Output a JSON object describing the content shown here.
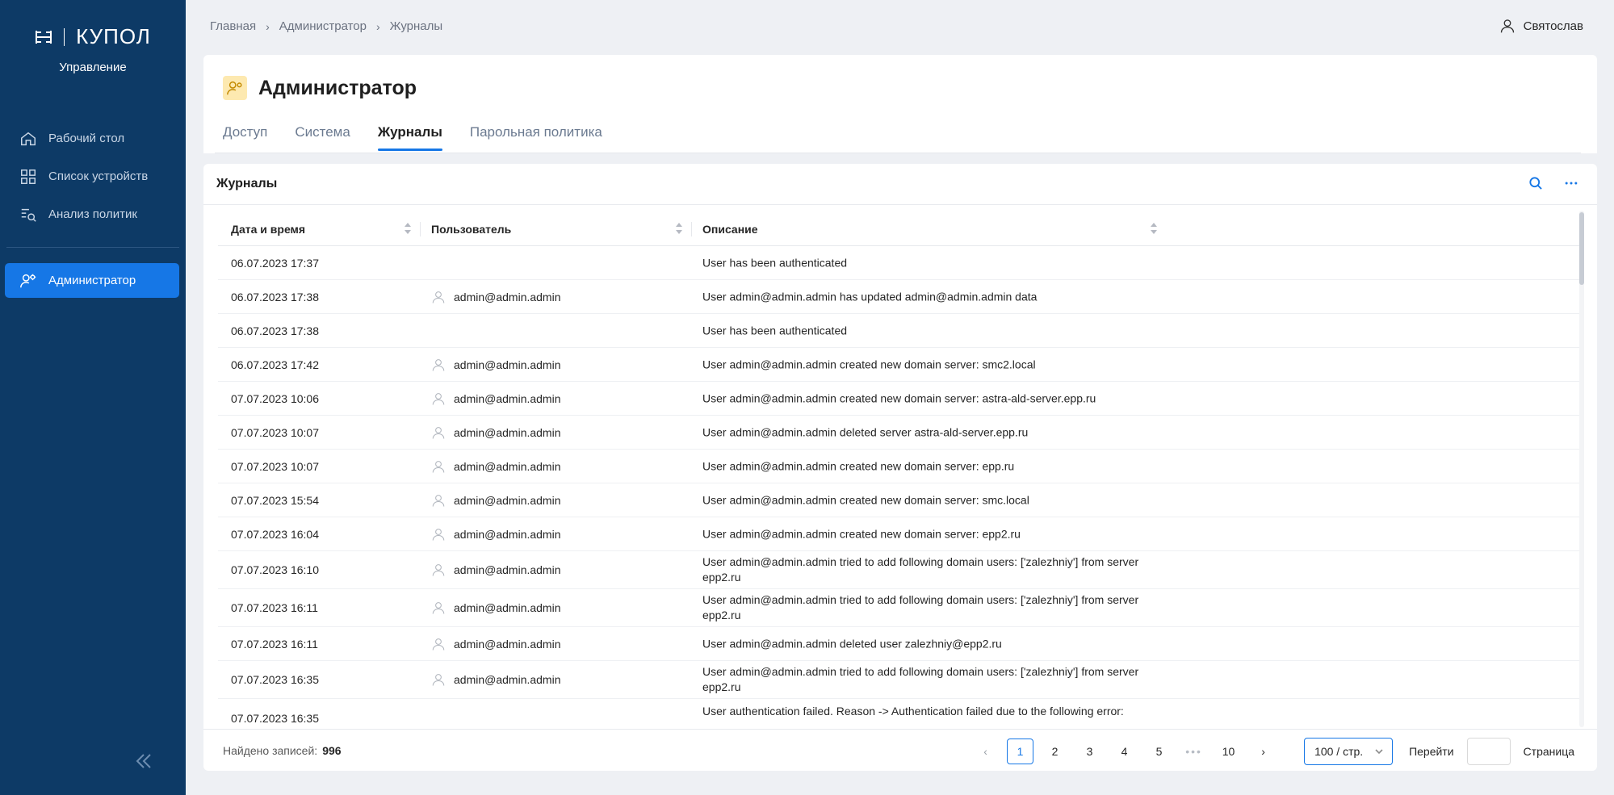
{
  "sidebar": {
    "logo_text": "КУПОЛ",
    "logo_sub": "Управление",
    "items": [
      {
        "label": "Рабочий стол"
      },
      {
        "label": "Список устройств"
      },
      {
        "label": "Анализ политик"
      }
    ],
    "active_item": "Администратор"
  },
  "breadcrumb": [
    "Главная",
    "Администратор",
    "Журналы"
  ],
  "user": {
    "name": "Святослав"
  },
  "page": {
    "title": "Администратор",
    "tabs": [
      "Доступ",
      "Система",
      "Журналы",
      "Парольная политика"
    ],
    "active_tab": "Журналы"
  },
  "journal": {
    "title": "Журналы",
    "columns": [
      "Дата и время",
      "Пользователь",
      "Описание"
    ],
    "rows": [
      {
        "date": "06.07.2023 17:37",
        "user": "",
        "desc": "User has been authenticated"
      },
      {
        "date": "06.07.2023 17:38",
        "user": "admin@admin.admin",
        "desc": "User admin@admin.admin has updated admin@admin.admin data"
      },
      {
        "date": "06.07.2023 17:38",
        "user": "",
        "desc": "User has been authenticated"
      },
      {
        "date": "06.07.2023 17:42",
        "user": "admin@admin.admin",
        "desc": "User admin@admin.admin created new domain server: smc2.local"
      },
      {
        "date": "07.07.2023 10:06",
        "user": "admin@admin.admin",
        "desc": "User admin@admin.admin created new domain server: astra-ald-server.epp.ru"
      },
      {
        "date": "07.07.2023 10:07",
        "user": "admin@admin.admin",
        "desc": "User admin@admin.admin deleted server astra-ald-server.epp.ru"
      },
      {
        "date": "07.07.2023 10:07",
        "user": "admin@admin.admin",
        "desc": "User admin@admin.admin created new domain server: epp.ru"
      },
      {
        "date": "07.07.2023 15:54",
        "user": "admin@admin.admin",
        "desc": "User admin@admin.admin created new domain server: smc.local"
      },
      {
        "date": "07.07.2023 16:04",
        "user": "admin@admin.admin",
        "desc": "User admin@admin.admin created new domain server: epp2.ru"
      },
      {
        "date": "07.07.2023 16:10",
        "user": "admin@admin.admin",
        "desc": "User admin@admin.admin tried to add following domain users: ['zalezhniy'] from server epp2.ru"
      },
      {
        "date": "07.07.2023 16:11",
        "user": "admin@admin.admin",
        "desc": "User admin@admin.admin tried to add following domain users: ['zalezhniy'] from server epp2.ru"
      },
      {
        "date": "07.07.2023 16:11",
        "user": "admin@admin.admin",
        "desc": "User admin@admin.admin deleted user zalezhniy@epp2.ru"
      },
      {
        "date": "07.07.2023 16:35",
        "user": "admin@admin.admin",
        "desc": "User admin@admin.admin tried to add following domain users: ['zalezhniy'] from server epp2.ru"
      },
      {
        "date": "07.07.2023 16:35",
        "user": "",
        "desc": "User authentication failed. Reason -> Authentication failed due to the following error:"
      }
    ]
  },
  "footer": {
    "found_label": "Найдено записей:",
    "found_count": "996",
    "pages": [
      "1",
      "2",
      "3",
      "4",
      "5",
      "•••",
      "10"
    ],
    "current_page": "1",
    "page_size": "100 / стр.",
    "goto_label": "Перейти",
    "page_label": "Страница"
  },
  "colors": {
    "sidebar_bg": "#0d3a66",
    "accent": "#1677e6",
    "title_icon_bg": "#fde9b0"
  }
}
